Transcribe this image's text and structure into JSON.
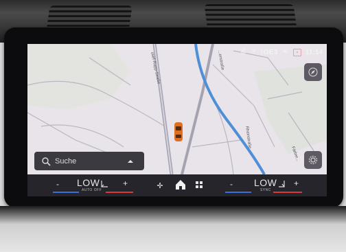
{
  "status_bar": {
    "signal": "!OE3",
    "time": "11:14"
  },
  "map": {
    "streets": [
      "osef-Rupp-Straße",
      "...enstraße",
      "Rheinstraße",
      "Färber..."
    ]
  },
  "search": {
    "label": "Suche"
  },
  "climate": {
    "left_minus": "-",
    "left_temp": "LOW",
    "left_mode": "AUTO OFF",
    "left_plus": "+",
    "right_minus": "-",
    "right_temp": "LOW",
    "right_mode": "SYNC",
    "right_plus": "+"
  },
  "colors": {
    "car_marker": "#e0701f",
    "road": "#9b99a6",
    "river": "#4f8fd6"
  },
  "icons": [
    "search-icon",
    "chevron-up-icon",
    "compass-icon",
    "settings-icon",
    "fan-icon",
    "home-icon",
    "apps-grid-icon",
    "seat-heat-icon",
    "bluetooth-icon",
    "navigation-arrow-icon",
    "mute-icon"
  ]
}
